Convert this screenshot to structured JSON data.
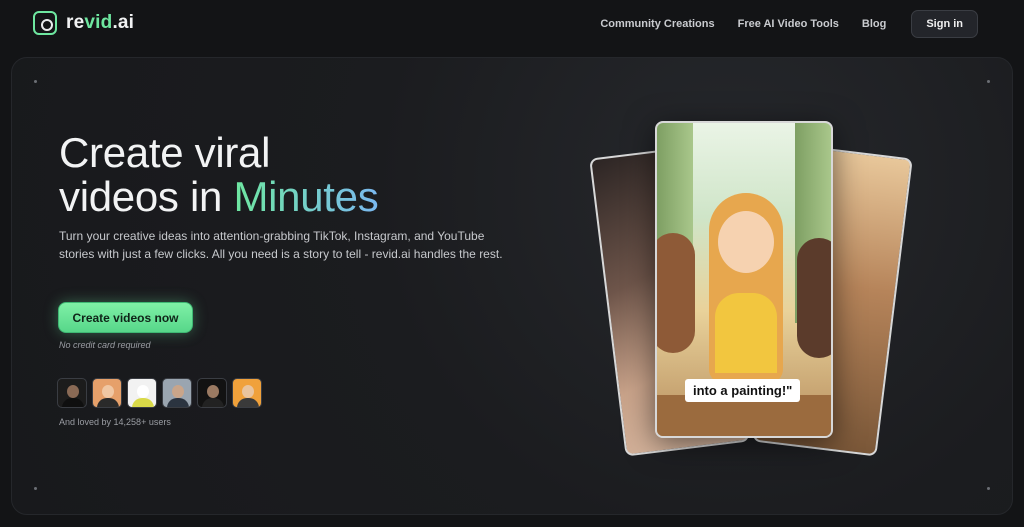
{
  "brand": {
    "name_part1": "re",
    "name_part2": "vid",
    "name_part3": ".ai",
    "accent": "#6ee7a0"
  },
  "nav": {
    "links": [
      "Community Creations",
      "Free AI Video Tools",
      "Blog"
    ],
    "signin": "Sign in"
  },
  "hero": {
    "title_line1": "Create viral",
    "title_line2_prefix": "videos in ",
    "title_line2_highlight": "Minutes",
    "subtitle": "Turn your creative ideas into attention-grabbing TikTok, Instagram, and YouTube stories with just a few clicks. All you need is a story to tell - revid.ai handles the rest.",
    "cta": "Create videos now",
    "note": "No credit card required",
    "loved": "And loved by 14,258+ users"
  },
  "avatars": [
    {
      "bg": "#1c1c1c",
      "skin": "#8a6a55",
      "shirt": "#0f0f0f"
    },
    {
      "bg": "#e6a06a",
      "skin": "#f0c7a3",
      "shirt": "#2a2a2a"
    },
    {
      "bg": "#f2f2f2",
      "skin": "#ffffff",
      "shirt": "#d9d948"
    },
    {
      "bg": "#9aa5b0",
      "skin": "#c9a58a",
      "shirt": "#2b3440"
    },
    {
      "bg": "#121212",
      "skin": "#9b7a62",
      "shirt": "#222222"
    },
    {
      "bg": "#f0a13b",
      "skin": "#e9c49e",
      "shirt": "#3a3a3a"
    }
  ],
  "card_caption": "into a painting!\""
}
